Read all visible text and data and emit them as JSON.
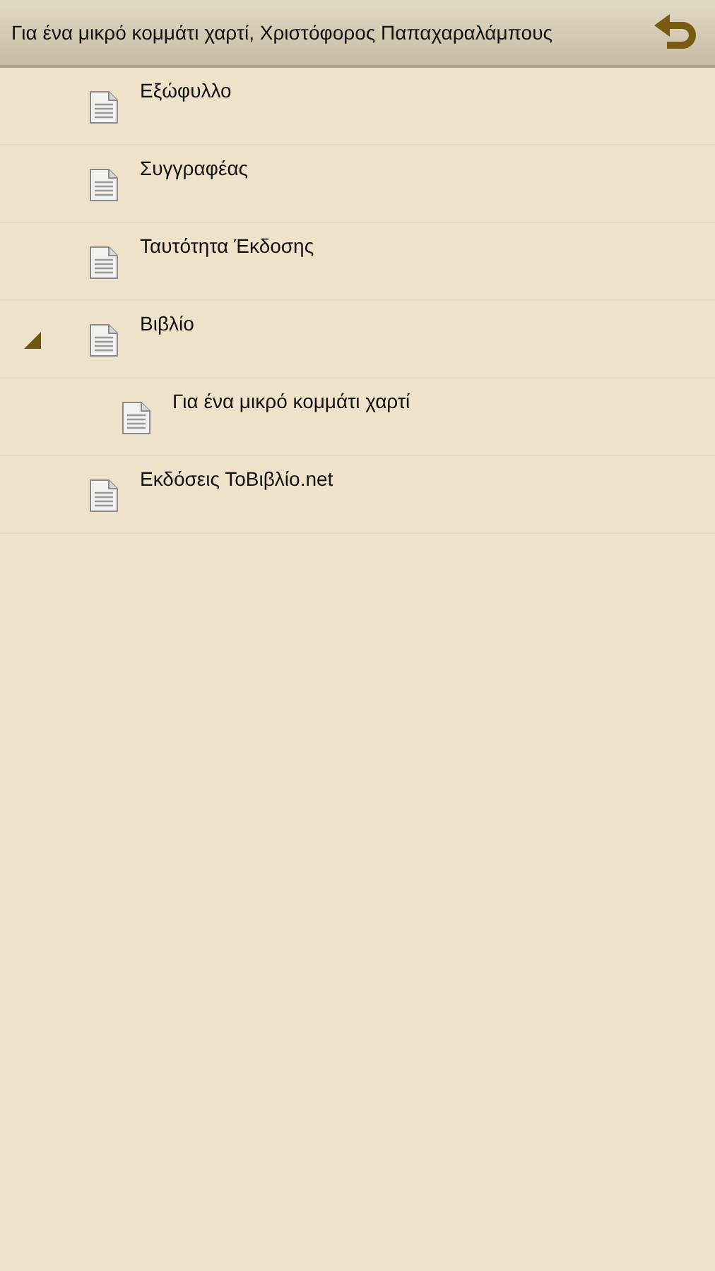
{
  "header": {
    "title": "Για ένα μικρό κομμάτι χαρτί, Χριστόφορος Παπαχαραλάμπους"
  },
  "toc": [
    {
      "label": "Εξώφυλλο"
    },
    {
      "label": "Συγγραφέας"
    },
    {
      "label": "Ταυτότητα Έκδοσης"
    },
    {
      "label": "Βιβλίο",
      "expanded": true,
      "children": [
        {
          "label": "Για ένα μικρό κομμάτι χαρτί"
        }
      ]
    },
    {
      "label": "Εκδόσεις ΤοΒιβλίο.net"
    }
  ]
}
